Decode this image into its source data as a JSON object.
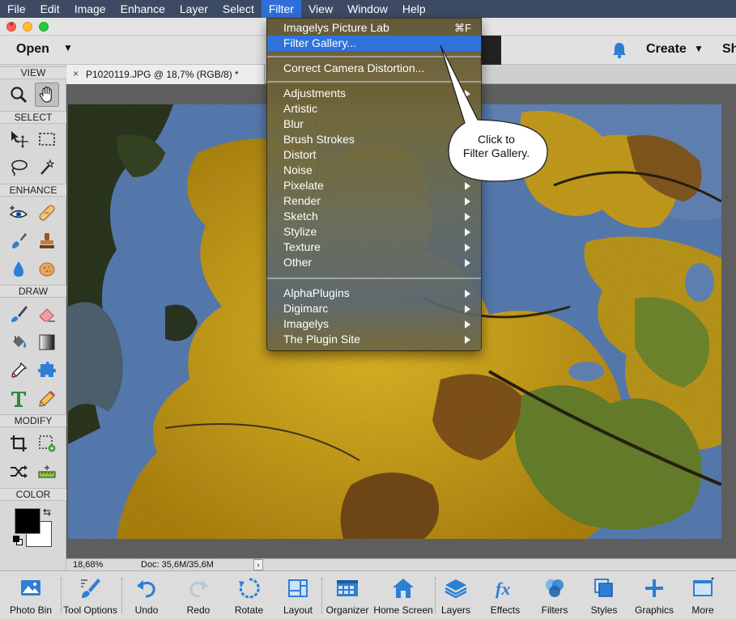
{
  "menubar": {
    "items": [
      {
        "label": "File"
      },
      {
        "label": "Edit"
      },
      {
        "label": "Image"
      },
      {
        "label": "Enhance"
      },
      {
        "label": "Layer"
      },
      {
        "label": "Select"
      },
      {
        "label": "Filter"
      },
      {
        "label": "View"
      },
      {
        "label": "Window"
      },
      {
        "label": "Help"
      }
    ],
    "active": "Filter"
  },
  "topbar": {
    "open_label": "Open",
    "create_label": "Create",
    "share_label": "Sh",
    "hidden_chunk": "t"
  },
  "toolbox": {
    "sections": {
      "view": "VIEW",
      "select": "SELECT",
      "enhance": "ENHANCE",
      "draw": "DRAW",
      "modify": "MODIFY",
      "color": "COLOR"
    }
  },
  "document": {
    "tab_close": "×",
    "tab_title": "P1020119.JPG @ 18,7% (RGB/8) *"
  },
  "status": {
    "zoom": "18,68%",
    "doc_info": "Doc: 35,6M/35,6M",
    "arrow": "›"
  },
  "filter_menu": {
    "items": [
      {
        "label": "Imagelys Picture Lab",
        "shortcut": "⌘F"
      },
      {
        "label": "Filter Gallery..."
      },
      {
        "label": "Correct Camera Distortion..."
      },
      {
        "label": "Adjustments"
      },
      {
        "label": "Artistic"
      },
      {
        "label": "Blur"
      },
      {
        "label": "Brush Strokes"
      },
      {
        "label": "Distort"
      },
      {
        "label": "Noise"
      },
      {
        "label": "Pixelate"
      },
      {
        "label": "Render"
      },
      {
        "label": "Sketch"
      },
      {
        "label": "Stylize"
      },
      {
        "label": "Texture"
      },
      {
        "label": "Other"
      },
      {
        "label": "AlphaPlugins"
      },
      {
        "label": "Digimarc"
      },
      {
        "label": "Imagelys"
      },
      {
        "label": "The Plugin Site"
      }
    ],
    "highlighted": "Filter Gallery..."
  },
  "callout": {
    "line1": "Click to",
    "line2": "Filter Gallery."
  },
  "bottombar": {
    "items": [
      {
        "label": "Photo Bin"
      },
      {
        "label": "Tool Options"
      },
      {
        "label": "Undo"
      },
      {
        "label": "Redo"
      },
      {
        "label": "Rotate"
      },
      {
        "label": "Layout"
      },
      {
        "label": "Organizer"
      },
      {
        "label": "Home Screen"
      },
      {
        "label": "Layers"
      },
      {
        "label": "Effects"
      },
      {
        "label": "Filters"
      },
      {
        "label": "Styles"
      },
      {
        "label": "Graphics"
      },
      {
        "label": "More"
      }
    ]
  },
  "colors": {
    "menubar_bg": "#3d4a63",
    "menu_highlight": "#2f72dc",
    "foreground_swatch": "#000000",
    "background_swatch": "#ffffff",
    "icon_blue": "#2d7fd3"
  }
}
